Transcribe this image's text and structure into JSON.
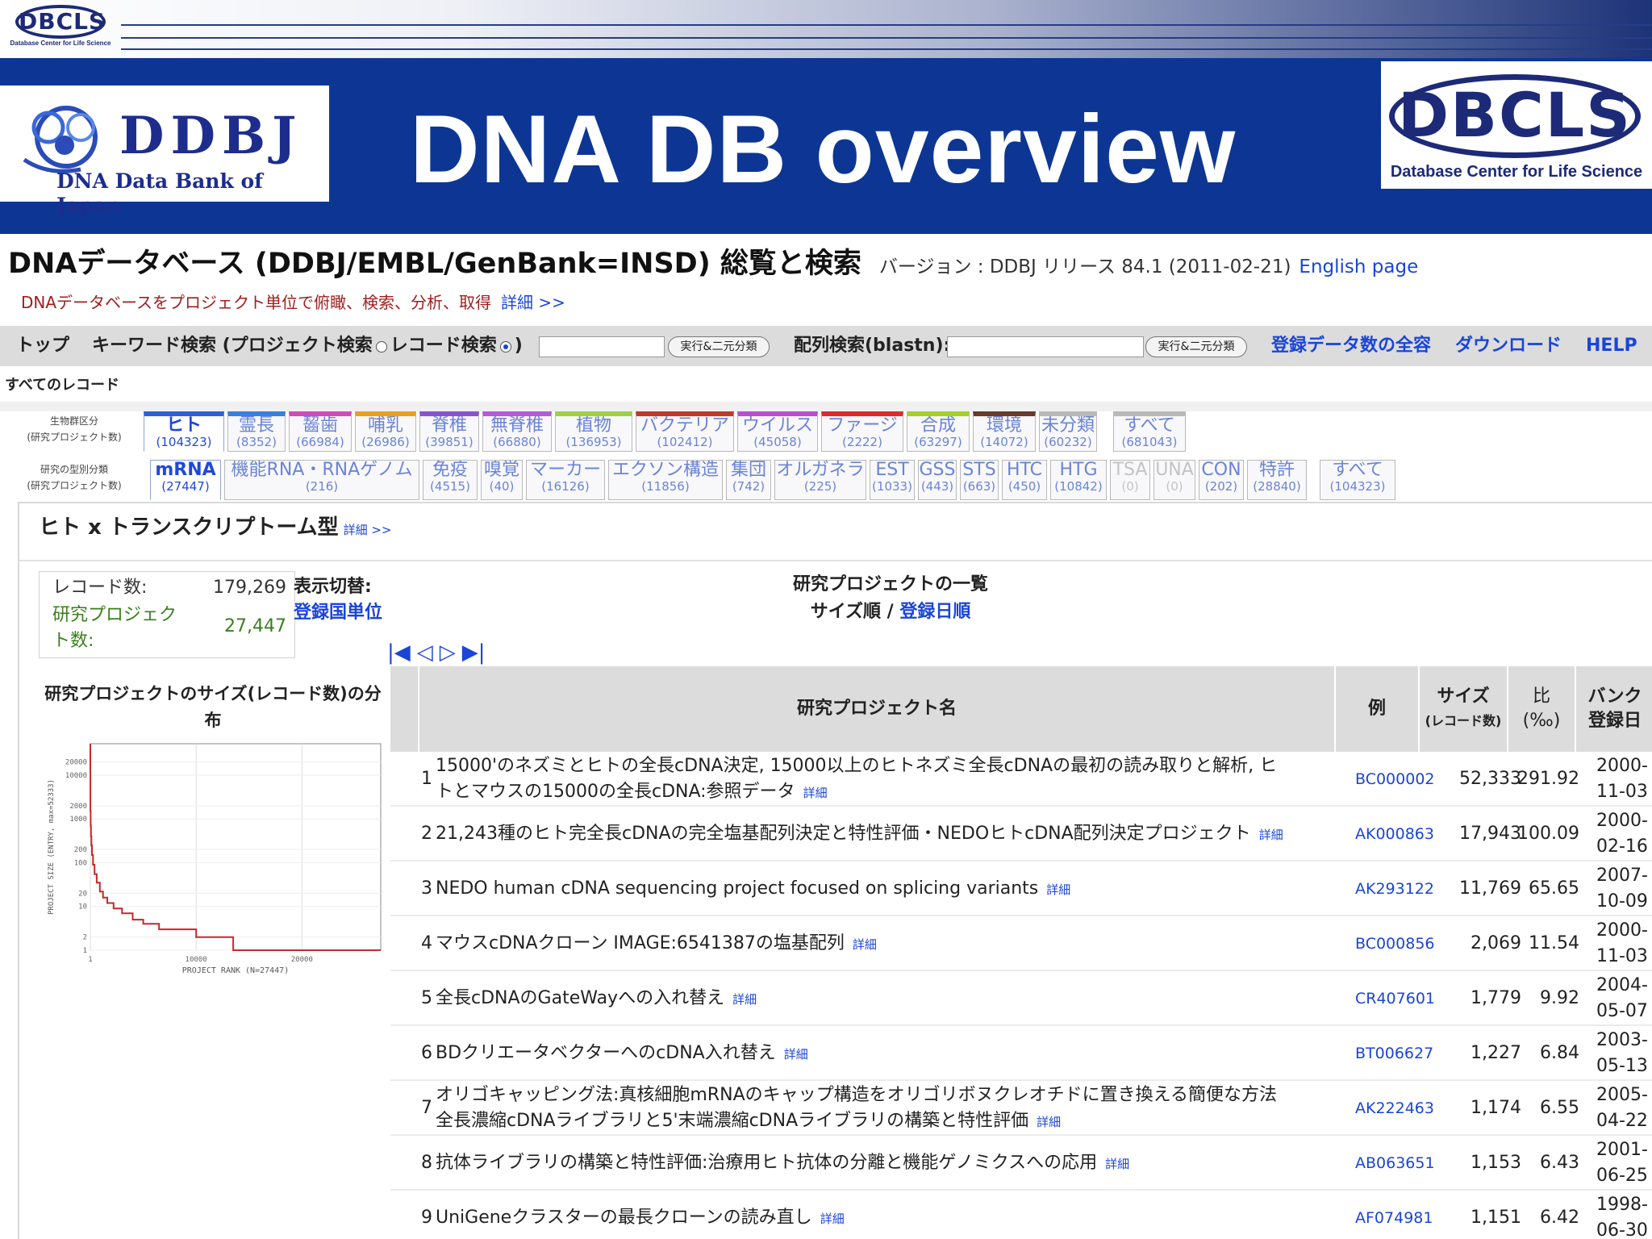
{
  "slide": {
    "small_logo_text": "DBCLS",
    "small_logo_caption": "Database Center for Life Science",
    "ddbj_logo_word": "DDBJ",
    "ddbj_logo_sub": "DNA Data Bank of Japan",
    "title": "DNA DB overview",
    "dbcls_logo_text": "DBCLS",
    "dbcls_logo_caption": "Database Center for Life Science"
  },
  "page": {
    "title": "DNAデータベース (DDBJ/EMBL/GenBank=INSD) 総覧と検索",
    "version": "バージョン : DDBJ リリース 84.1 (2011-02-21)",
    "english_link": "English page",
    "subtitle": "DNAデータベースをプロジェクト単位で俯瞰、検索、分析、取得",
    "subtitle_more": "詳細 >>",
    "all_records": "すべてのレコード"
  },
  "nav": {
    "top": "トップ",
    "keyword_search": "キーワード検索 (プロジェクト検索",
    "record_search": "レコード検索",
    "close_paren": ")",
    "run_button": "実行&二元分類",
    "blast_label": "配列検索(blastn):",
    "blast_button": "実行&二元分類",
    "links": [
      "登録データ数の全容",
      "ダウンロード",
      "HELP"
    ]
  },
  "organism_tabs": {
    "label": "生物群区分\n(研究プロジェクト数)",
    "items": [
      {
        "name": "ヒト",
        "count": "(104323)",
        "color": "#2f5fd8",
        "state": "active"
      },
      {
        "name": "霊長",
        "count": "(8352)",
        "color": "#3a7fe0",
        "state": "normal"
      },
      {
        "name": "齧歯",
        "count": "(66984)",
        "color": "#d04bb8",
        "state": "normal"
      },
      {
        "name": "哺乳",
        "count": "(26986)",
        "color": "#e9a020",
        "state": "normal"
      },
      {
        "name": "脊椎",
        "count": "(39851)",
        "color": "#8a52d0",
        "state": "normal"
      },
      {
        "name": "無脊椎",
        "count": "(66880)",
        "color": "#b45ad8",
        "state": "normal"
      },
      {
        "name": "植物",
        "count": "(136953)",
        "color": "#9fd043",
        "state": "normal"
      },
      {
        "name": "バクテリア",
        "count": "(102412)",
        "color": "#c0392b",
        "state": "normal"
      },
      {
        "name": "ウイルス",
        "count": "(45058)",
        "color": "#b74fd0",
        "state": "normal"
      },
      {
        "name": "ファージ",
        "count": "(2222)",
        "color": "#e02a2a",
        "state": "normal"
      },
      {
        "name": "合成",
        "count": "(63297)",
        "color": "#a6d028",
        "state": "normal"
      },
      {
        "name": "環境",
        "count": "(14072)",
        "color": "#6b3b2a",
        "state": "normal"
      },
      {
        "name": "未分類",
        "count": "(60232)",
        "color": "#b9b9b9",
        "state": "normal"
      },
      {
        "name": "すべて",
        "count": "(681043)",
        "color": "#b9b9b9",
        "state": "normal"
      }
    ]
  },
  "type_tabs": {
    "label": "研究の型別分類\n(研究プロジェクト数)",
    "items": [
      {
        "name": "mRNA",
        "count": "(27447)",
        "state": "active"
      },
      {
        "name": "機能RNA・RNAゲノム",
        "count": "(216)",
        "state": "normal"
      },
      {
        "name": "免疫",
        "count": "(4515)",
        "state": "normal"
      },
      {
        "name": "嗅覚",
        "count": "(40)",
        "state": "normal"
      },
      {
        "name": "マーカー",
        "count": "(16126)",
        "state": "normal"
      },
      {
        "name": "エクソン構造",
        "count": "(11856)",
        "state": "normal"
      },
      {
        "name": "集団",
        "count": "(742)",
        "state": "normal"
      },
      {
        "name": "オルガネラ",
        "count": "(225)",
        "state": "normal"
      },
      {
        "name": "EST",
        "count": "(1033)",
        "state": "normal"
      },
      {
        "name": "GSS",
        "count": "(443)",
        "state": "normal"
      },
      {
        "name": "STS",
        "count": "(663)",
        "state": "normal"
      },
      {
        "name": "HTC",
        "count": "(450)",
        "state": "normal"
      },
      {
        "name": "HTG",
        "count": "(10842)",
        "state": "normal"
      },
      {
        "name": "TSA",
        "count": "(0)",
        "state": "disabled"
      },
      {
        "name": "UNA",
        "count": "(0)",
        "state": "disabled"
      },
      {
        "name": "CON",
        "count": "(202)",
        "state": "normal"
      },
      {
        "name": "特許",
        "count": "(28840)",
        "state": "normal"
      },
      {
        "name": "すべて",
        "count": "(104323)",
        "state": "normal"
      }
    ]
  },
  "section": {
    "title": "ヒト x トランスクリプトーム型",
    "title_more": "詳細 >>",
    "records_label": "レコード数:",
    "records_value": "179,269",
    "projects_label": "研究プロジェクト数:",
    "projects_value": "27,447",
    "display_label": "表示切替:",
    "display_value": "登録国単位",
    "dist_title": "研究プロジェクトのサイズ(レコード数)の分布",
    "list_title": "研究プロジェクトの一覧",
    "sort_current": "サイズ順",
    "sort_sep": " / ",
    "sort_alt": "登録日順",
    "pager": [
      "|◀",
      "◁",
      "▷",
      "▶|"
    ]
  },
  "table": {
    "headers": {
      "name": "研究プロジェクト名",
      "example": "例",
      "size": "サイズ",
      "size_unit": "(レコード数)",
      "ratio": "比",
      "ratio_unit": "(‰)",
      "date": "バンク登録日"
    },
    "more_label": "詳細",
    "rows": [
      {
        "idx": "1",
        "name": "15000'のネズミとヒトの全長cDNA決定, 15000以上のヒトネズミ全長cDNAの最初の読み取りと解析, ヒトとマウスの15000の全長cDNA:参照データ",
        "example": "BC000002",
        "size": "52,333",
        "ratio": "291.92",
        "date": "2000-11-03"
      },
      {
        "idx": "2",
        "name": "21,243種のヒト完全長cDNAの完全塩基配列決定と特性評価・NEDOヒトcDNA配列決定プロジェクト",
        "example": "AK000863",
        "size": "17,943",
        "ratio": "100.09",
        "date": "2000-02-16"
      },
      {
        "idx": "3",
        "name": "NEDO human cDNA sequencing project focused on splicing variants",
        "example": "AK293122",
        "size": "11,769",
        "ratio": "65.65",
        "date": "2007-10-09"
      },
      {
        "idx": "4",
        "name": "マウスcDNAクローン IMAGE:6541387の塩基配列",
        "example": "BC000856",
        "size": "2,069",
        "ratio": "11.54",
        "date": "2000-11-03"
      },
      {
        "idx": "5",
        "name": "全長cDNAのGateWayへの入れ替え",
        "example": "CR407601",
        "size": "1,779",
        "ratio": "9.92",
        "date": "2004-05-07"
      },
      {
        "idx": "6",
        "name": "BDクリエータベクターへのcDNA入れ替え",
        "example": "BT006627",
        "size": "1,227",
        "ratio": "6.84",
        "date": "2003-05-13"
      },
      {
        "idx": "7",
        "name": "オリゴキャッピング法:真核細胞mRNAのキャップ構造をオリゴリボヌクレオチドに置き換える簡便な方法 全長濃縮cDNAライブラリと5'末端濃縮cDNAライブラリの構築と特性評価",
        "example": "AK222463",
        "size": "1,174",
        "ratio": "6.55",
        "date": "2005-04-22"
      },
      {
        "idx": "8",
        "name": "抗体ライブラリの構築と特性評価:治療用ヒト抗体の分離と機能ゲノミクスへの応用",
        "example": "AB063651",
        "size": "1,153",
        "ratio": "6.43",
        "date": "2001-06-25"
      },
      {
        "idx": "9",
        "name": "UniGeneクラスターの最長クローンの読み直し",
        "example": "AF074981",
        "size": "1,151",
        "ratio": "6.42",
        "date": "1998-06-30"
      }
    ]
  },
  "chart_data": {
    "type": "line",
    "xlabel": "PROJECT RANK (N=27447)",
    "ylabel": "PROJECT SIZE (ENTRY, max=52333)",
    "x_ticks": [
      "1",
      "10000",
      "20000"
    ],
    "y_ticks": [
      "1",
      "2",
      "10",
      "20",
      "100",
      "200",
      "1000",
      "2000",
      "10000",
      "20000"
    ],
    "y_scale": "log",
    "xlim": [
      1,
      27447
    ],
    "ylim": [
      1,
      52333
    ],
    "grid": true,
    "series": [
      {
        "color": "#c62828",
        "x": [
          1,
          3,
          10,
          30,
          60,
          100,
          150,
          250,
          400,
          600,
          900,
          1200,
          1600,
          2200,
          3000,
          4000,
          5000,
          6500,
          8000,
          10000,
          12500,
          13500,
          16000,
          20000,
          24000,
          27447
        ],
        "y": [
          52333,
          11769,
          1500,
          700,
          400,
          250,
          150,
          90,
          55,
          35,
          22,
          16,
          12,
          9,
          7,
          5,
          4,
          3,
          3,
          2,
          2,
          1,
          1,
          1,
          1,
          1
        ]
      }
    ]
  }
}
